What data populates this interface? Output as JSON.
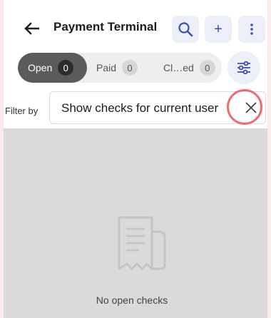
{
  "header": {
    "title": "Payment Terminal",
    "back_icon": "arrow-left-icon",
    "actions": [
      {
        "icon": "search-icon"
      },
      {
        "icon": "plus-icon",
        "glyph": "+"
      },
      {
        "icon": "more-vertical-icon"
      }
    ]
  },
  "tabs": [
    {
      "label": "Open",
      "count": "0",
      "selected": true
    },
    {
      "label": "Paid",
      "count": "0",
      "selected": false
    },
    {
      "label": "Cl…ed",
      "count": "0",
      "selected": false
    }
  ],
  "filter_settings_icon": "sliders-icon",
  "filter": {
    "label": "Filter by",
    "value": "Show checks for current user",
    "clear_icon": "close-icon"
  },
  "empty_state": {
    "icon": "receipt-icon",
    "message": "No open checks"
  },
  "colors": {
    "accent": "#3b4bb8",
    "selected_tab": "#5b5b5b",
    "highlight": "#ef6b72",
    "content_background": "#dadada"
  }
}
